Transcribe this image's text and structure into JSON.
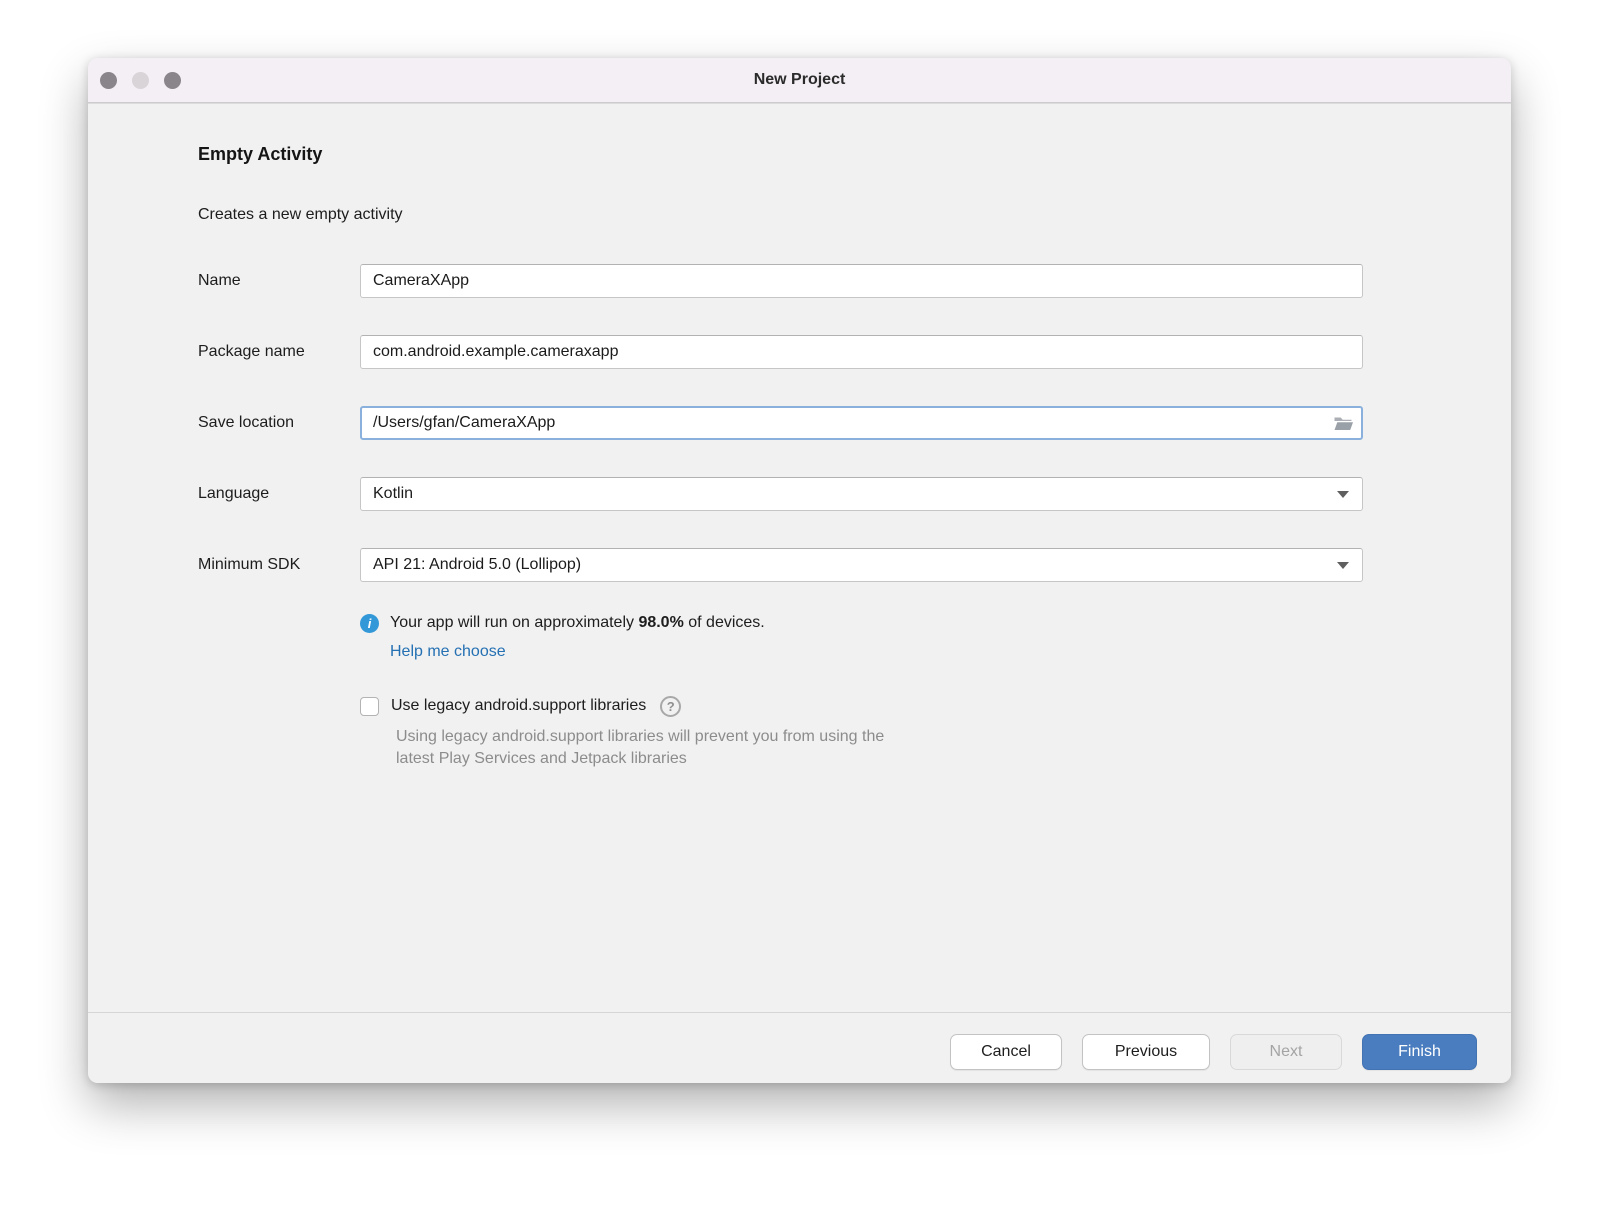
{
  "window": {
    "title": "New Project",
    "traffic_lights": [
      "close",
      "minimize",
      "zoom"
    ]
  },
  "header": {
    "title": "Empty Activity",
    "subtitle": "Creates a new empty activity"
  },
  "form": {
    "name": {
      "label": "Name",
      "value": "CameraXApp"
    },
    "package": {
      "label": "Package name",
      "value": "com.android.example.cameraxapp"
    },
    "save_location": {
      "label": "Save location",
      "value": "/Users/gfan/CameraXApp",
      "icon": "folder-open-icon"
    },
    "language": {
      "label": "Language",
      "value": "Kotlin"
    },
    "minimum_sdk": {
      "label": "Minimum SDK",
      "value": "API 21: Android 5.0 (Lollipop)"
    },
    "sdk_info": {
      "icon": "info-icon",
      "text_prefix": "Your app will run on approximately ",
      "percent": "98.0%",
      "text_suffix": " of devices.",
      "link": "Help me choose"
    },
    "legacy_support": {
      "checked": false,
      "label": "Use legacy android.support libraries",
      "help_icon": "help-icon",
      "description": "Using legacy android.support libraries will prevent you from using the latest Play Services and Jetpack libraries"
    }
  },
  "footer": {
    "cancel_label": "Cancel",
    "previous_label": "Previous",
    "next_label": "Next",
    "next_enabled": false,
    "finish_label": "Finish"
  },
  "colors": {
    "finish_button": "#4a7dbf",
    "link": "#2470b3",
    "info_icon": "#3398d8",
    "focus_ring": "#8ab1dd",
    "titlebar_bg": "#f4eff4",
    "content_bg": "#f1f1f1"
  }
}
